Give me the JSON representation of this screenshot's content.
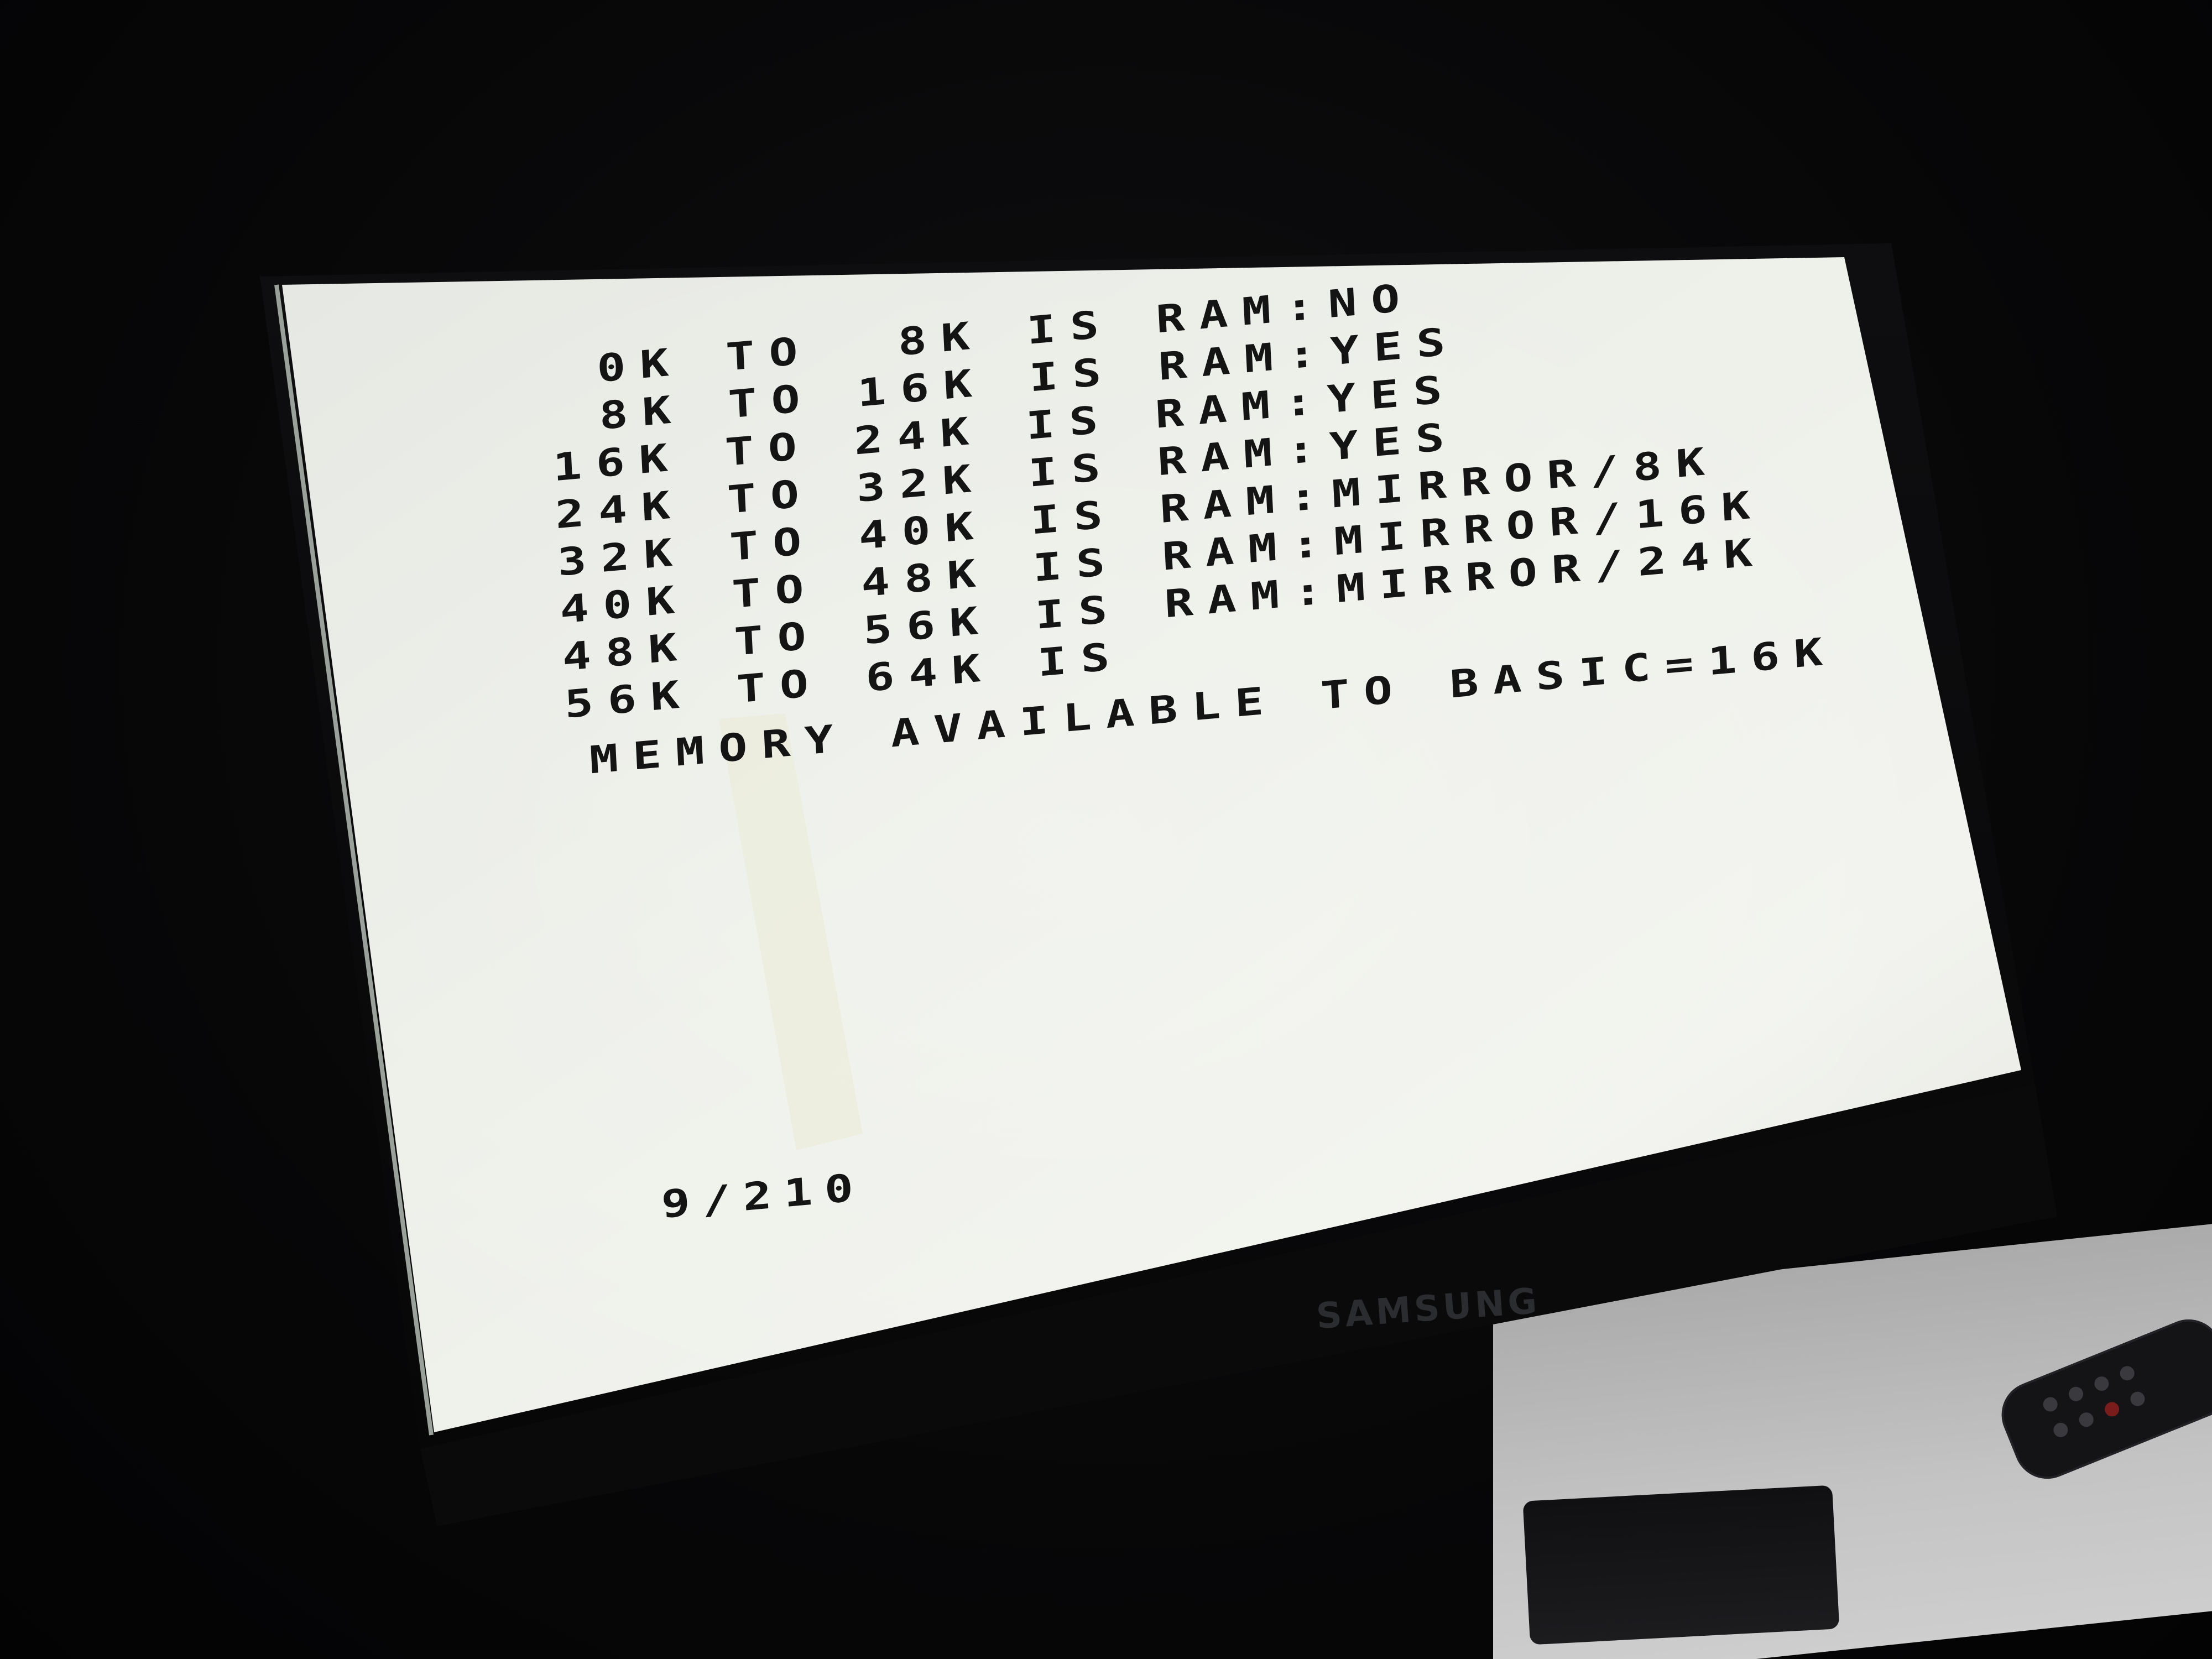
{
  "monitor": {
    "brand": "SAMSUNG"
  },
  "screen": {
    "memory_map": [
      {
        "text": " 0K TO  8K IS RAM:NO"
      },
      {
        "text": " 8K TO 16K IS RAM:YES"
      },
      {
        "text": "16K TO 24K IS RAM:YES"
      },
      {
        "text": "24K TO 32K IS RAM:YES"
      },
      {
        "text": "32K TO 40K IS RAM:MIRROR/8K"
      },
      {
        "text": "40K TO 48K IS RAM:MIRROR/16K"
      },
      {
        "text": "48K TO 56K IS RAM:MIRROR/24K"
      },
      {
        "text": "56K TO 64K IS"
      }
    ],
    "memory_available": "MEMORY AVAILABLE TO BASIC=16K",
    "report_code": "9/210"
  },
  "colors": {
    "screen_background": "#e9ebe6",
    "text": "#141414",
    "bezel": "#0b0b0c"
  }
}
